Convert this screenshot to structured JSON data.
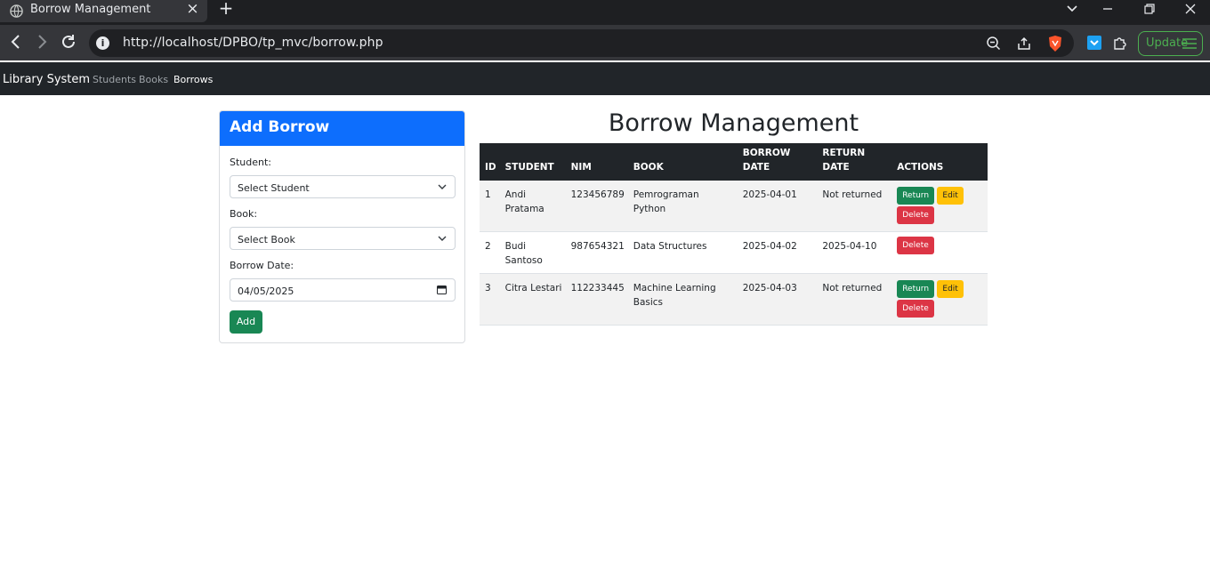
{
  "browser": {
    "tab_title": "Borrow Management",
    "url": "http://localhost/DPBO/tp_mvc/borrow.php",
    "update_label": "Update"
  },
  "navbar": {
    "brand": "Library System",
    "links": [
      {
        "label": "Students",
        "active": false
      },
      {
        "label": "Books",
        "active": false
      },
      {
        "label": "Borrows",
        "active": true
      }
    ]
  },
  "form": {
    "title": "Add Borrow",
    "student_label": "Student:",
    "student_value": "Select Student",
    "book_label": "Book:",
    "book_value": "Select Book",
    "date_label": "Borrow Date:",
    "date_value": "04/05/2025",
    "submit_label": "Add"
  },
  "main": {
    "heading": "Borrow Management",
    "columns": [
      "ID",
      "STUDENT",
      "NIM",
      "BOOK",
      "BORROW DATE",
      "RETURN DATE",
      "ACTIONS"
    ],
    "rows": [
      {
        "id": "1",
        "student": "Andi Pratama",
        "nim": "123456789",
        "book": "Pemrograman Python",
        "borrow_date": "2025-04-01",
        "return_date": "Not returned",
        "actions": [
          "Return",
          "Edit",
          "Delete"
        ]
      },
      {
        "id": "2",
        "student": "Budi Santoso",
        "nim": "987654321",
        "book": "Data Structures",
        "borrow_date": "2025-04-02",
        "return_date": "2025-04-10",
        "actions": [
          "Delete"
        ]
      },
      {
        "id": "3",
        "student": "Citra Lestari",
        "nim": "112233445",
        "book": "Machine Learning Basics",
        "borrow_date": "2025-04-03",
        "return_date": "Not returned",
        "actions": [
          "Return",
          "Edit",
          "Delete"
        ]
      }
    ]
  },
  "colors": {
    "primary": "#0d6efd",
    "success": "#198754",
    "warning": "#ffc107",
    "danger": "#dc3545",
    "dark": "#212529"
  }
}
